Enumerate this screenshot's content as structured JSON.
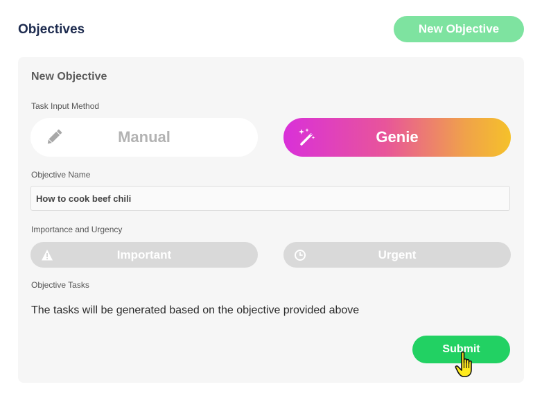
{
  "header": {
    "title": "Objectives",
    "new_objective_label": "New Objective"
  },
  "form": {
    "title": "New Objective",
    "task_input_method_label": "Task Input Method",
    "methods": {
      "manual_label": "Manual",
      "manual_icon": "pencil-icon",
      "genie_label": "Genie",
      "genie_icon": "magic-wand-icon"
    },
    "objective_name_label": "Objective Name",
    "objective_name_value": "How to cook beef chili",
    "importance_label": "Importance and Urgency",
    "important_label": "Important",
    "important_icon": "warning-icon",
    "urgent_label": "Urgent",
    "urgent_icon": "clock-icon",
    "objective_tasks_label": "Objective Tasks",
    "tasks_message": "The tasks will be generated based on the objective provided above",
    "submit_label": "Submit"
  },
  "colors": {
    "title": "#1d2b4f",
    "new_objective_button": "#7ee3a0",
    "submit_button": "#22d163",
    "card_background": "#f6f6f6",
    "pill_inactive": "#d9d9d9",
    "genie_gradient_start": "#d930d9",
    "genie_gradient_end": "#f5c12a"
  }
}
